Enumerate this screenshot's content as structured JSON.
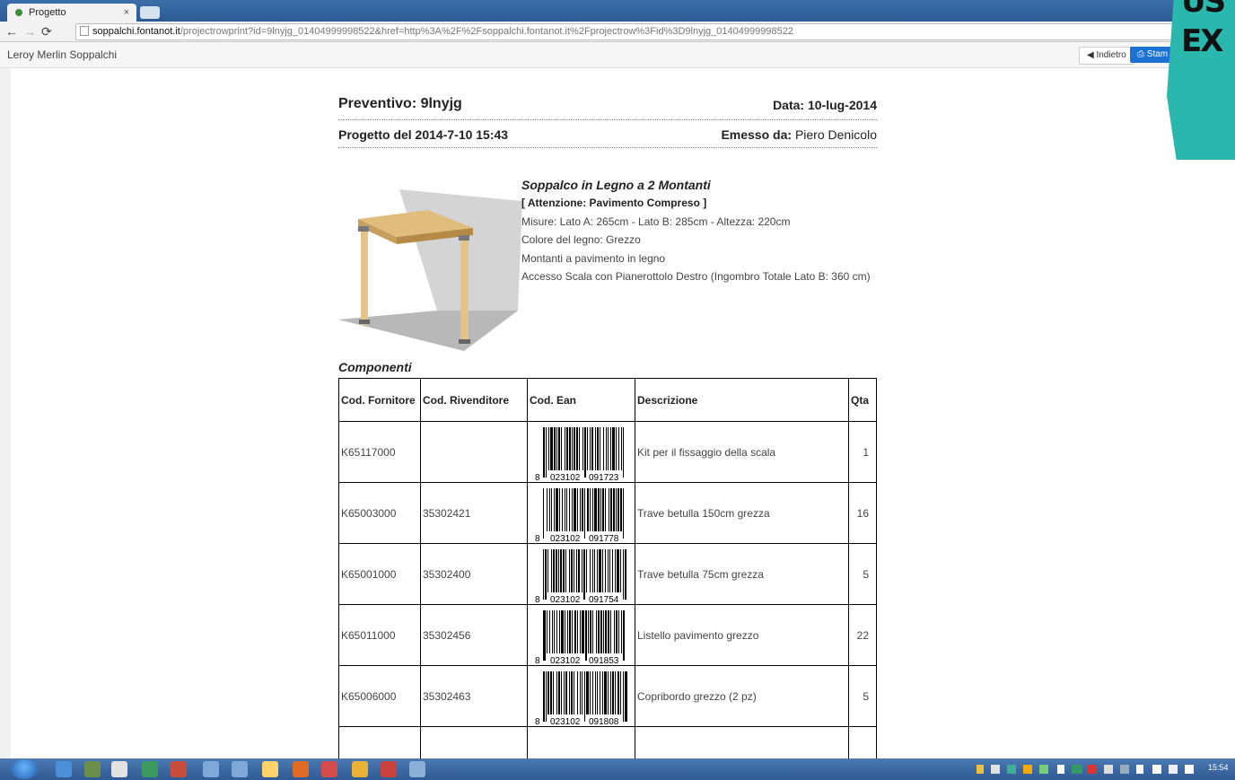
{
  "browser": {
    "tab_title": "Progetto",
    "tab_close": "×",
    "url_host": "soppalchi.fontanot.it",
    "url_rest": "/projectrowprint?id=9lnyjg_01404999998522&href=http%3A%2F%2Fsoppalchi.fontanot.it%2Fprojectrow%3Fid%3D9lnyjg_01404999998522"
  },
  "appbar": {
    "brand": "Leroy Merlin Soppalchi",
    "back_label": "◀ Indietro",
    "print_label": "⎙ Stam"
  },
  "promo": {
    "line1": "US",
    "line2": "EX"
  },
  "document": {
    "preventivo": "Preventivo: 9lnyjg",
    "data": "Data: 10-lug-2014",
    "progetto": "Progetto del 2014-7-10 15:43",
    "emesso_label": "Emesso da:",
    "emesso_value": "Piero Denicolo"
  },
  "product": {
    "title": "Soppalco in Legno a 2 Montanti",
    "warning": "[ Attenzione: Pavimento Compreso ]",
    "misure": "Misure: Lato A: 265cm - Lato B: 285cm - Altezza: 220cm",
    "colore": "Colore del legno: Grezzo",
    "montanti": "Montanti a pavimento in legno",
    "accesso": "Accesso Scala con Pianerottolo Destro (Ingombro Totale Lato B: 360 cm)"
  },
  "components": {
    "heading": "Componenti",
    "headers": [
      "Cod. Fornitore",
      "Cod. Rivenditore",
      "Cod. Ean",
      "Descrizione",
      "Qta"
    ],
    "rows": [
      {
        "fornitore": "K65117000",
        "rivenditore": "",
        "ean_a": "8",
        "ean_b": "023102",
        "ean_c": "091723",
        "descrizione": "Kit per il fissaggio della scala",
        "qta": "1"
      },
      {
        "fornitore": "K65003000",
        "rivenditore": "35302421",
        "ean_a": "8",
        "ean_b": "023102",
        "ean_c": "091778",
        "descrizione": "Trave betulla 150cm grezza",
        "qta": "16"
      },
      {
        "fornitore": "K65001000",
        "rivenditore": "35302400",
        "ean_a": "8",
        "ean_b": "023102",
        "ean_c": "091754",
        "descrizione": "Trave betulla 75cm grezza",
        "qta": "5"
      },
      {
        "fornitore": "K65011000",
        "rivenditore": "35302456",
        "ean_a": "8",
        "ean_b": "023102",
        "ean_c": "091853",
        "descrizione": "Listello pavimento grezzo",
        "qta": "22"
      },
      {
        "fornitore": "K65006000",
        "rivenditore": "35302463",
        "ean_a": "8",
        "ean_b": "023102",
        "ean_c": "091808",
        "descrizione": "Copribordo grezzo (2 pz)",
        "qta": "5"
      }
    ]
  },
  "taskbar": {
    "clock": "15:54"
  }
}
